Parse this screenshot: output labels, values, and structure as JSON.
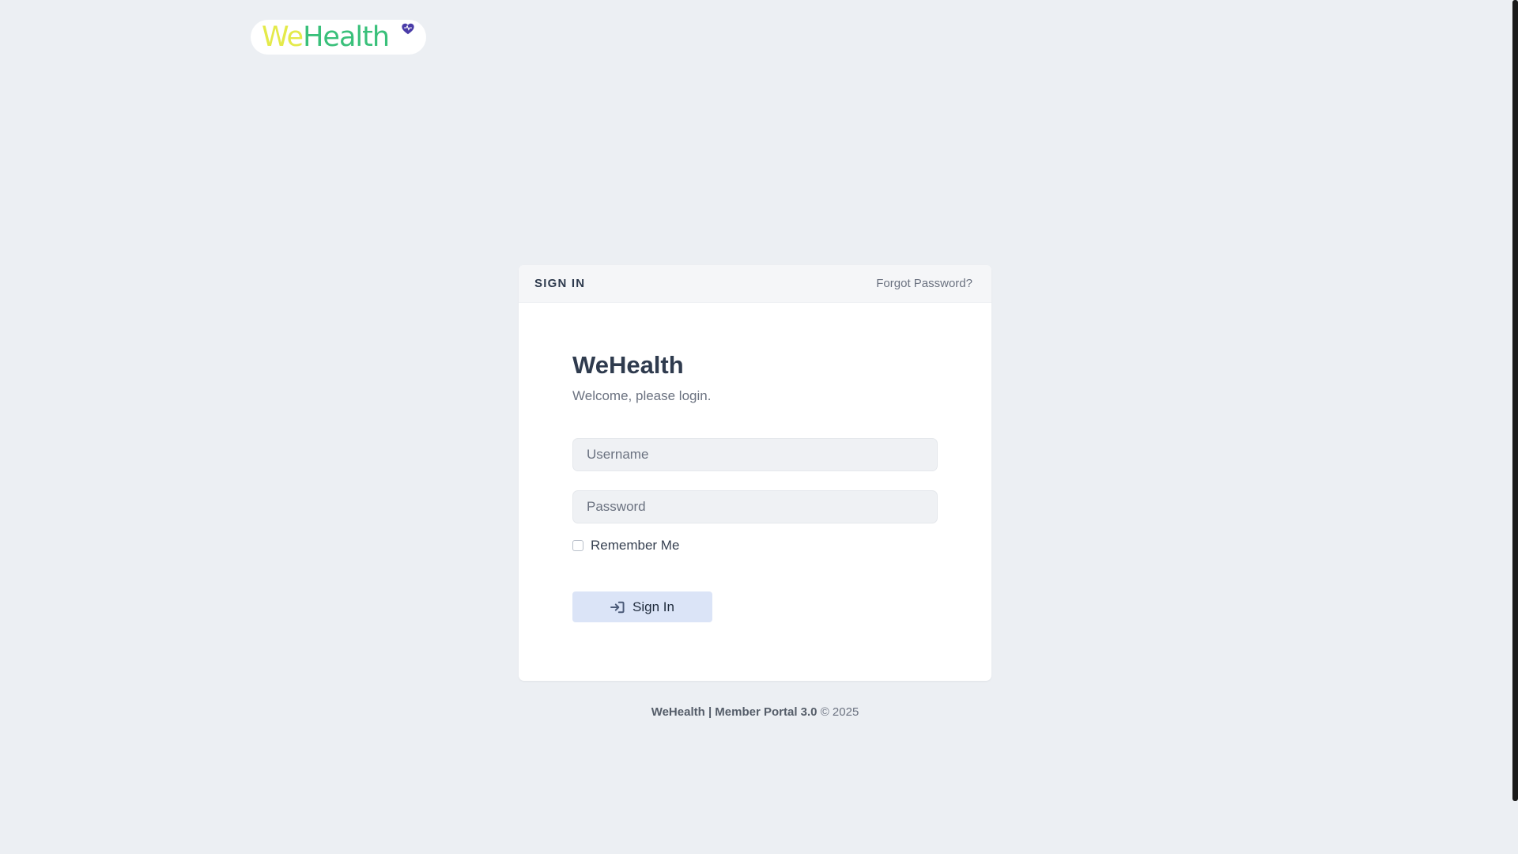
{
  "logo": {
    "we": "We",
    "health": "Health"
  },
  "card": {
    "header_title": "SIGN IN",
    "forgot_link": "Forgot Password?",
    "brand_title": "WeHealth",
    "brand_subtitle": "Welcome, please login.",
    "username_placeholder": "Username",
    "username_value": "",
    "password_placeholder": "Password",
    "password_value": "",
    "remember_label": "Remember Me",
    "remember_checked": false,
    "signin_label": "Sign In"
  },
  "footer": {
    "brand": "WeHealth | Member Portal 3.0",
    "copyright": "© 2025"
  },
  "icons": {
    "signin": "sign-in-arrow-icon",
    "logo_heart": "heart-icon"
  },
  "colors": {
    "background": "#eceff3",
    "card": "#ffffff",
    "button": "#dbe4f7",
    "logo_we": "#e4ea4a",
    "logo_health": "#39c07a",
    "heart": "#4a3ca8"
  }
}
